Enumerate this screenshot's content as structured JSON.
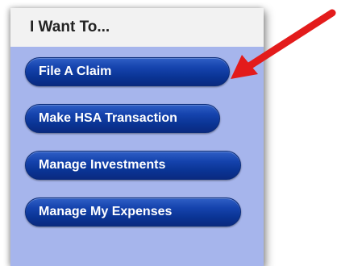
{
  "panel": {
    "title": "I Want To..."
  },
  "actions": [
    {
      "label": "File A Claim"
    },
    {
      "label": "Make HSA Transaction"
    },
    {
      "label": "Manage Investments"
    },
    {
      "label": "Manage My Expenses"
    }
  ],
  "colors": {
    "panel_bg": "#a6b5ec",
    "header_bg": "#f2f2f2",
    "button_blue": "#1543ad",
    "arrow_red": "#e31b1b"
  },
  "icons": {
    "annotation": "red-arrow-icon"
  }
}
